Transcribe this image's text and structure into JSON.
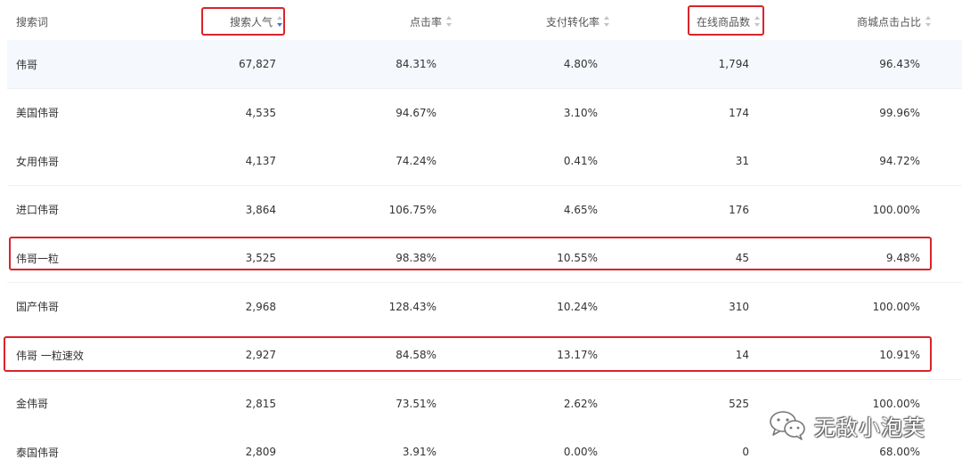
{
  "table": {
    "columns": {
      "keyword": "搜索词",
      "popularity": "搜索人气",
      "ctr": "点击率",
      "pay_rate": "支付转化率",
      "online_items": "在线商品数",
      "mall_share": "商城点击占比"
    },
    "active_sort": "popularity",
    "rows": [
      {
        "keyword": "伟哥",
        "popularity": "67,827",
        "ctr": "84.31%",
        "pay_rate": "4.80%",
        "online_items": "1,794",
        "mall_share": "96.43%",
        "highlighted": false
      },
      {
        "keyword": "美国伟哥",
        "popularity": "4,535",
        "ctr": "94.67%",
        "pay_rate": "3.10%",
        "online_items": "174",
        "mall_share": "99.96%",
        "highlighted": false
      },
      {
        "keyword": "女用伟哥",
        "popularity": "4,137",
        "ctr": "74.24%",
        "pay_rate": "0.41%",
        "online_items": "31",
        "mall_share": "94.72%",
        "highlighted": false
      },
      {
        "keyword": "进口伟哥",
        "popularity": "3,864",
        "ctr": "106.75%",
        "pay_rate": "4.65%",
        "online_items": "176",
        "mall_share": "100.00%",
        "highlighted": false
      },
      {
        "keyword": "伟哥一粒",
        "popularity": "3,525",
        "ctr": "98.38%",
        "pay_rate": "10.55%",
        "online_items": "45",
        "mall_share": "9.48%",
        "highlighted": true
      },
      {
        "keyword": "国产伟哥",
        "popularity": "2,968",
        "ctr": "128.43%",
        "pay_rate": "10.24%",
        "online_items": "310",
        "mall_share": "100.00%",
        "highlighted": false
      },
      {
        "keyword": "伟哥 一粒速效",
        "popularity": "2,927",
        "ctr": "84.58%",
        "pay_rate": "13.17%",
        "online_items": "14",
        "mall_share": "10.91%",
        "highlighted": true
      },
      {
        "keyword": "金伟哥",
        "popularity": "2,815",
        "ctr": "73.51%",
        "pay_rate": "2.62%",
        "online_items": "525",
        "mall_share": "100.00%",
        "highlighted": false
      },
      {
        "keyword": "泰国伟哥",
        "popularity": "2,809",
        "ctr": "3.91%",
        "pay_rate": "0.00%",
        "online_items": "0",
        "mall_share": "68.00%",
        "highlighted": false
      }
    ]
  },
  "watermark": {
    "text": "无敌小泡芙",
    "icon": "wechat-icon"
  },
  "colors": {
    "highlight_border": "#d9232b",
    "sort_active": "#3b73d9",
    "row_hover": "#f5f8fd"
  }
}
